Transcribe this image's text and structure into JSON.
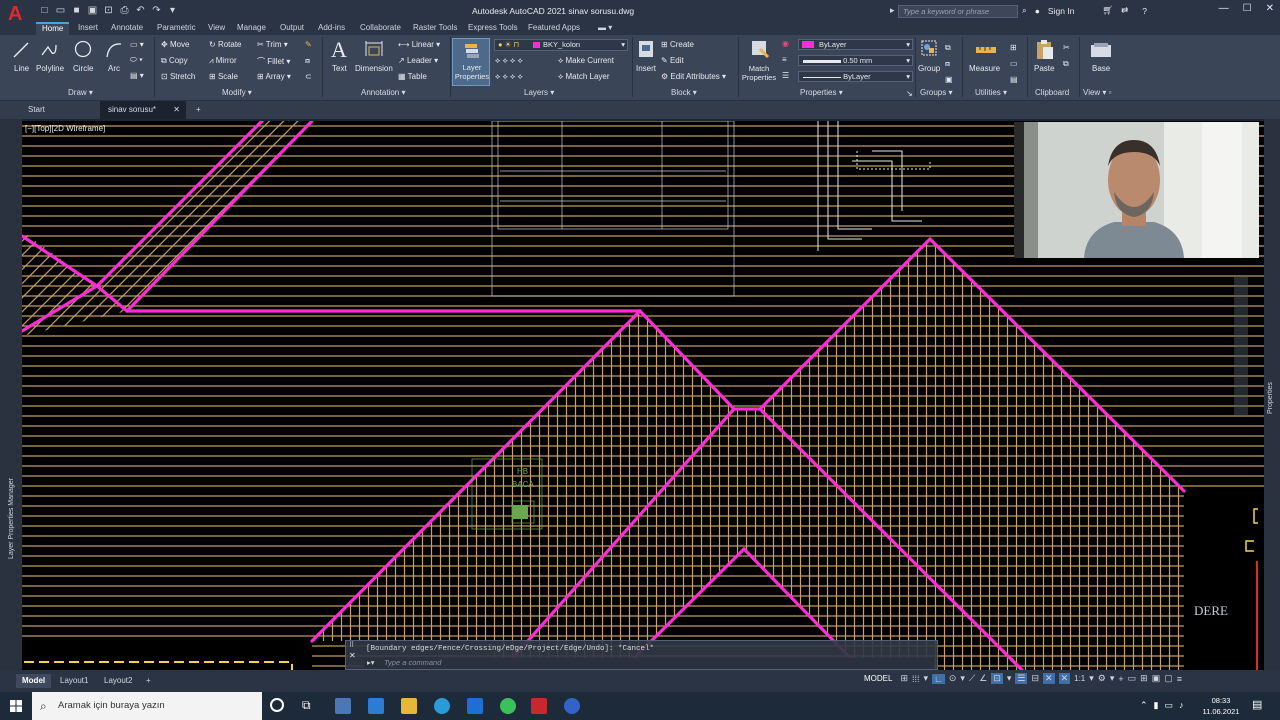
{
  "app": {
    "title": "Autodesk AutoCAD 2021   sinav sorusu.dwg",
    "search_placeholder": "Type a keyword or phrase",
    "sign_in": "Sign In",
    "logo": "A"
  },
  "ribbon_tabs": [
    "Home",
    "Insert",
    "Annotate",
    "Parametric",
    "View",
    "Manage",
    "Output",
    "Add-ins",
    "Collaborate",
    "Raster Tools",
    "Express Tools",
    "Featured Apps"
  ],
  "ribbon": {
    "draw": {
      "title": "Draw",
      "line": "Line",
      "polyline": "Polyline",
      "circle": "Circle",
      "arc": "Arc"
    },
    "modify": {
      "title": "Modify",
      "move": "Move",
      "rotate": "Rotate",
      "trim": "Trim",
      "copy": "Copy",
      "mirror": "Mirror",
      "fillet": "Fillet",
      "stretch": "Stretch",
      "scale": "Scale",
      "array": "Array"
    },
    "annotation": {
      "title": "Annotation",
      "text": "Text",
      "dimension": "Dimension",
      "linear": "Linear",
      "leader": "Leader",
      "table": "Table"
    },
    "layers": {
      "title": "Layers",
      "layer_properties": "Layer Properties",
      "current_layer": "BKY_kolon",
      "make_current": "Make Current",
      "match_layer": "Match Layer"
    },
    "block": {
      "title": "Block",
      "insert": "Insert",
      "create": "Create",
      "edit": "Edit",
      "edit_attributes": "Edit Attributes"
    },
    "properties": {
      "title": "Properties",
      "match_properties": "Match Properties",
      "color": "ByLayer",
      "lineweight": "0.50 mm",
      "linetype": "ByLayer"
    },
    "groups": {
      "title": "Groups",
      "group": "Group"
    },
    "utilities": {
      "title": "Utilities",
      "measure": "Measure"
    },
    "clipboard": {
      "title": "Clipboard",
      "paste": "Paste"
    },
    "view": {
      "title": "View",
      "base": "Base"
    }
  },
  "doc_tabs": {
    "start": "Start",
    "file": "sinav sorusu*"
  },
  "viewport_label": "[−][Top][2D Wireframe]",
  "side_palettes": {
    "left": "Layer Properties Manager",
    "right": "Properties"
  },
  "drawing_text": {
    "hb": "HB",
    "baca": "BACA",
    "dere": "DERE"
  },
  "command": {
    "history": "[Boundary edges/Fence/Crossing/eDge/Project/Edge/Undo]: *Cancel*",
    "placeholder": "Type a command"
  },
  "layout_tabs": [
    "Model",
    "Layout1",
    "Layout2"
  ],
  "status": {
    "space": "MODEL",
    "scale": "1:1"
  },
  "taskbar": {
    "search": "Aramak için buraya yazın",
    "time": "08:33",
    "date": "11.06.2021"
  },
  "colors": {
    "accent_magenta": "#ff2bd6",
    "hatch_tan": "#c9a268",
    "canvas_bg": "#000000",
    "ribbon_bg": "#3b4558"
  }
}
